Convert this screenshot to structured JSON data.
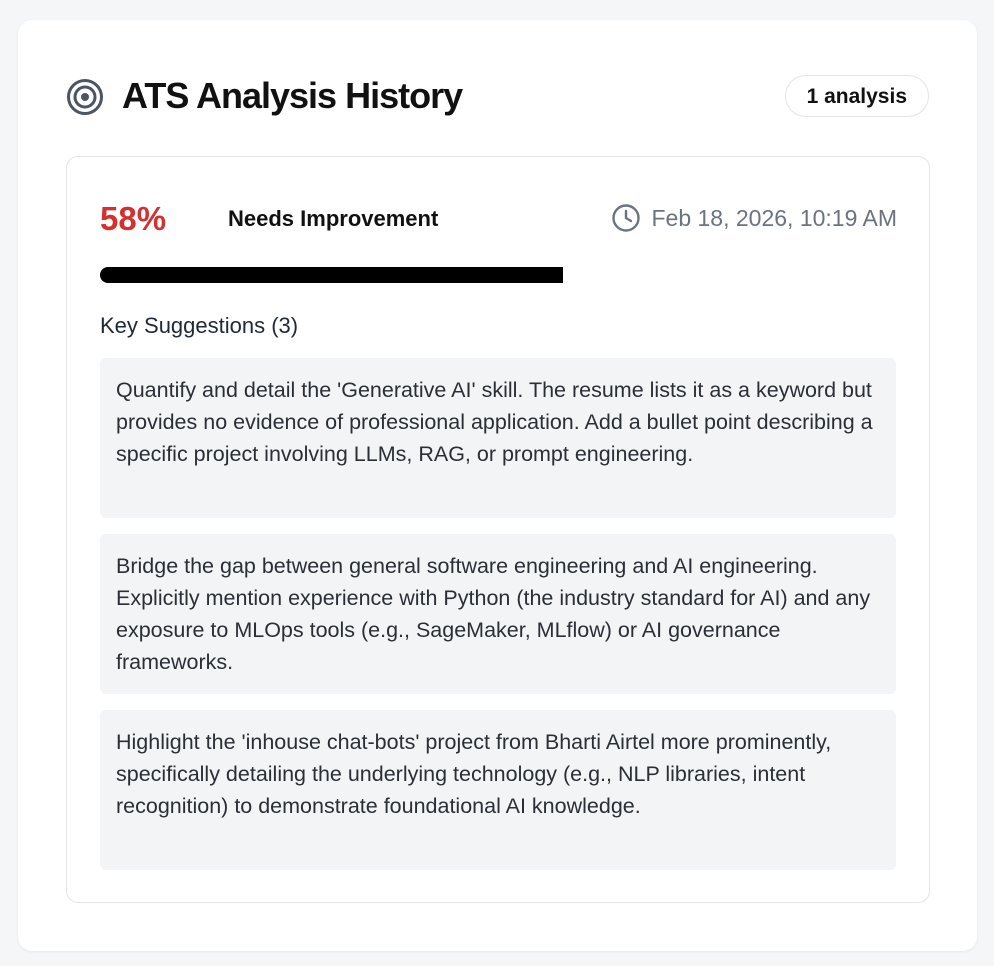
{
  "header": {
    "title": "ATS Analysis History",
    "count_label": "1 analysis",
    "icon": "target-icon"
  },
  "analysis": {
    "score": "58%",
    "score_value": 0.58,
    "status": "Needs Improvement",
    "timestamp": "Feb 18, 2026, 10:19 AM",
    "clock_icon": "clock-icon",
    "suggestions_title": "Key Suggestions (3)",
    "suggestions": [
      "Quantify and detail the 'Generative AI' skill. The resume lists it as a keyword but provides no evidence of professional application. Add a bullet point describing a specific project involving LLMs, RAG, or prompt engineering.",
      "Bridge the gap between general software engineering and AI engineering. Explicitly mention experience with Python (the industry standard for AI) and any exposure to MLOps tools (e.g., SageMaker, MLflow) or AI governance frameworks.",
      "Highlight the 'inhouse chat-bots' project from Bharti Airtel more prominently, specifically detailing the underlying technology (e.g., NLP libraries, intent recognition) to demonstrate foundational AI knowledge."
    ]
  },
  "colors": {
    "score": "#d43030",
    "progress_fill": "#000000",
    "suggestion_bg": "#f3f4f6",
    "muted_text": "#6b7280"
  }
}
